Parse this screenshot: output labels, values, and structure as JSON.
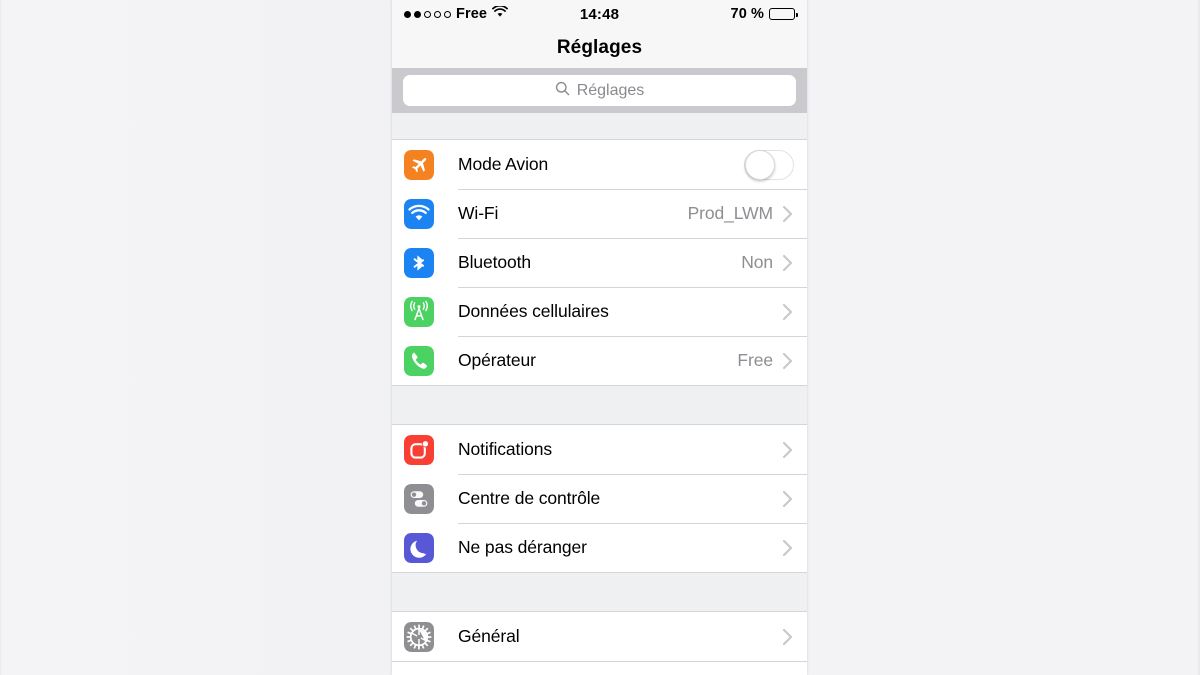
{
  "status_bar": {
    "signal_dots_filled": 2,
    "signal_dots_total": 5,
    "carrier": "Free",
    "wifi_icon": "wifi-icon",
    "time": "14:48",
    "battery_percent_label": "70 %",
    "battery_level": 70
  },
  "nav": {
    "title": "Réglages"
  },
  "search": {
    "icon": "search-icon",
    "placeholder": "Réglages",
    "value": ""
  },
  "colors": {
    "airplane": "#f58220",
    "wifi": "#1b84f2",
    "bluetooth": "#1b84f2",
    "cellular": "#4cd263",
    "carrier_phone": "#4cd263",
    "notifications": "#f93e34",
    "control_center": "#8e8e93",
    "do_not_disturb": "#5857d6",
    "general": "#8e8e93",
    "value_text": "#8e8e93",
    "chevron": "#c7c7cc",
    "separator": "#d5d5d9",
    "group_background": "#eff0f2",
    "search_bar_background": "#c9c9ce"
  },
  "groups": [
    {
      "name": "connectivity",
      "rows": [
        {
          "icon": "airplane-icon",
          "label": "Mode Avion",
          "value": "",
          "accessory": "toggle",
          "toggle_on": false
        },
        {
          "icon": "wifi-icon",
          "label": "Wi-Fi",
          "value": "Prod_LWM",
          "accessory": "chevron"
        },
        {
          "icon": "bluetooth-icon",
          "label": "Bluetooth",
          "value": "Non",
          "accessory": "chevron"
        },
        {
          "icon": "cellular-icon",
          "label": "Données cellulaires",
          "value": "",
          "accessory": "chevron"
        },
        {
          "icon": "phone-icon",
          "label": "Opérateur",
          "value": "Free",
          "accessory": "chevron"
        }
      ]
    },
    {
      "name": "alerts",
      "rows": [
        {
          "icon": "notifications-icon",
          "label": "Notifications",
          "value": "",
          "accessory": "chevron"
        },
        {
          "icon": "control-center-icon",
          "label": "Centre de contrôle",
          "value": "",
          "accessory": "chevron"
        },
        {
          "icon": "moon-icon",
          "label": "Ne pas déranger",
          "value": "",
          "accessory": "chevron"
        }
      ]
    },
    {
      "name": "system",
      "rows": [
        {
          "icon": "gear-icon",
          "label": "Général",
          "value": "",
          "accessory": "chevron"
        }
      ]
    }
  ]
}
